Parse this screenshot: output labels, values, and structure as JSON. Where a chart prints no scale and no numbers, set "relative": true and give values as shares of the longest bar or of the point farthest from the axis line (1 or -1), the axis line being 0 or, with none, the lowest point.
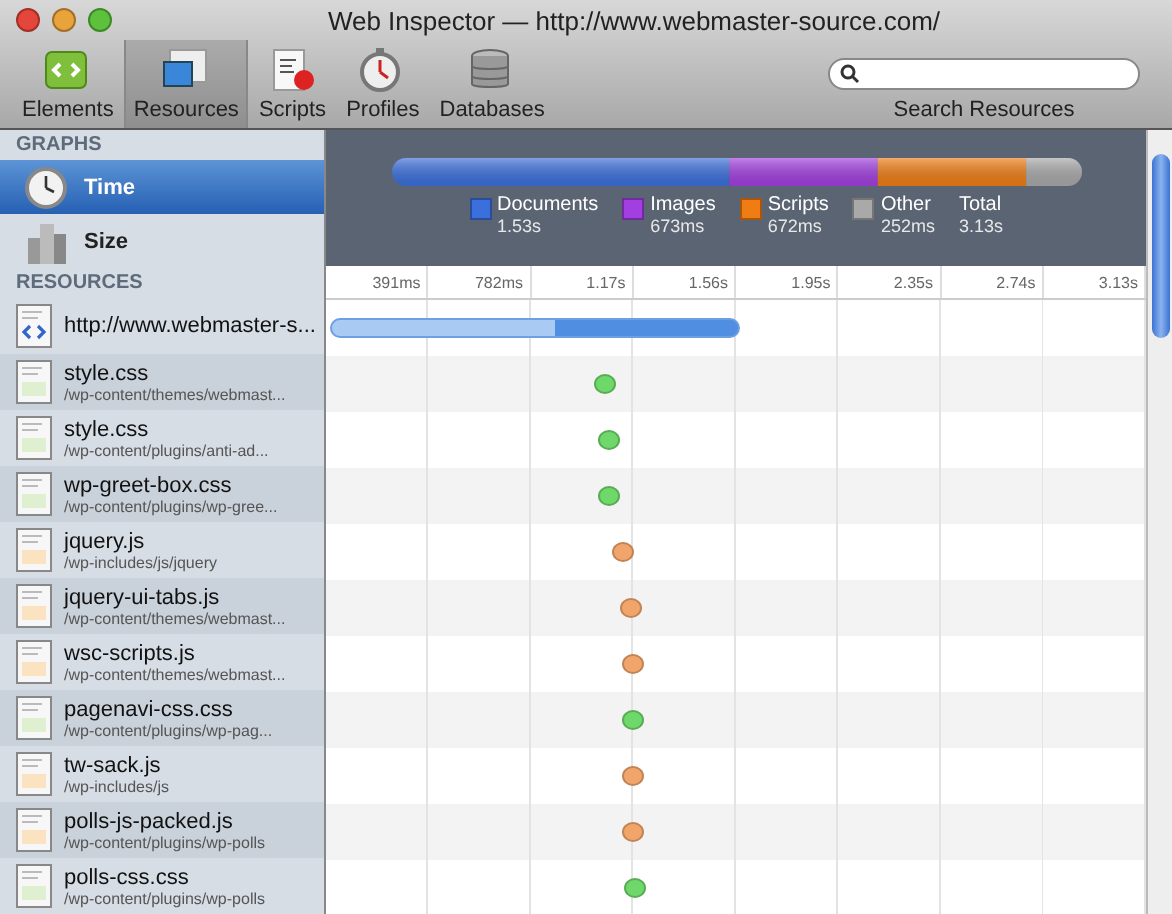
{
  "window": {
    "title": "Web Inspector — http://www.webmaster-source.com/"
  },
  "toolbar": [
    {
      "label": "Elements",
      "kind": "elements",
      "selected": false
    },
    {
      "label": "Resources",
      "kind": "resources",
      "selected": true
    },
    {
      "label": "Scripts",
      "kind": "scripts",
      "selected": false
    },
    {
      "label": "Profiles",
      "kind": "profiles",
      "selected": false
    },
    {
      "label": "Databases",
      "kind": "databases",
      "selected": false
    }
  ],
  "search": {
    "label": "Search Resources"
  },
  "sidebar": {
    "graphs_heading": "GRAPHS",
    "graphs": [
      {
        "label": "Time",
        "kind": "time",
        "selected": true
      },
      {
        "label": "Size",
        "kind": "size",
        "selected": false
      }
    ],
    "resources_heading": "RESOURCES"
  },
  "summary_chart": {
    "chart_data": {
      "type": "bar",
      "orientation": "horizontal",
      "stacked": true,
      "relative": true,
      "value_labels": [
        "1.53s",
        "673ms",
        "672ms",
        "252ms"
      ],
      "series": [
        {
          "name": "Documents",
          "color": "#3b6fdc",
          "values": [
            0.489
          ]
        },
        {
          "name": "Images",
          "color": "#a23fe0",
          "values": [
            0.215
          ]
        },
        {
          "name": "Scripts",
          "color": "#ef7d14",
          "values": [
            0.215
          ]
        },
        {
          "name": "Other",
          "color": "#a9a9a9",
          "values": [
            0.081
          ]
        }
      ]
    }
  },
  "total": {
    "label": "Total",
    "value": "3.13s"
  },
  "ticks": [
    "391ms",
    "782ms",
    "1.17s",
    "1.56s",
    "1.95s",
    "2.35s",
    "2.74s",
    "3.13s"
  ],
  "resources": [
    {
      "name": "http://www.webmaster-s...",
      "kind": "html",
      "level": 0.5
    },
    {
      "name": "style.css",
      "path": "/wp-content/themes/webmast...",
      "kind": "css",
      "level": 0.34
    },
    {
      "name": "style.css",
      "path": "/wp-content/plugins/anti-ad...",
      "kind": "css",
      "level": 0.345
    },
    {
      "name": "wp-greet-box.css",
      "path": "/wp-content/plugins/wp-gree...",
      "kind": "css",
      "level": 0.345
    },
    {
      "name": "jquery.js",
      "path": "/wp-includes/js/jquery",
      "kind": "js",
      "level": 0.36
    },
    {
      "name": "jquery-ui-tabs.js",
      "path": "/wp-content/themes/webmast...",
      "kind": "js",
      "level": 0.37
    },
    {
      "name": "wsc-scripts.js",
      "path": "/wp-content/themes/webmast...",
      "kind": "js",
      "level": 0.372
    },
    {
      "name": "pagenavi-css.css",
      "path": "/wp-content/plugins/wp-pag...",
      "kind": "css",
      "level": 0.373
    },
    {
      "name": "tw-sack.js",
      "path": "/wp-includes/js",
      "kind": "js",
      "level": 0.374
    },
    {
      "name": "polls-js-packed.js",
      "path": "/wp-content/plugins/wp-polls",
      "kind": "js",
      "level": 0.374
    },
    {
      "name": "polls-css.css",
      "path": "/wp-content/plugins/wp-polls",
      "kind": "css",
      "level": 0.375
    }
  ]
}
